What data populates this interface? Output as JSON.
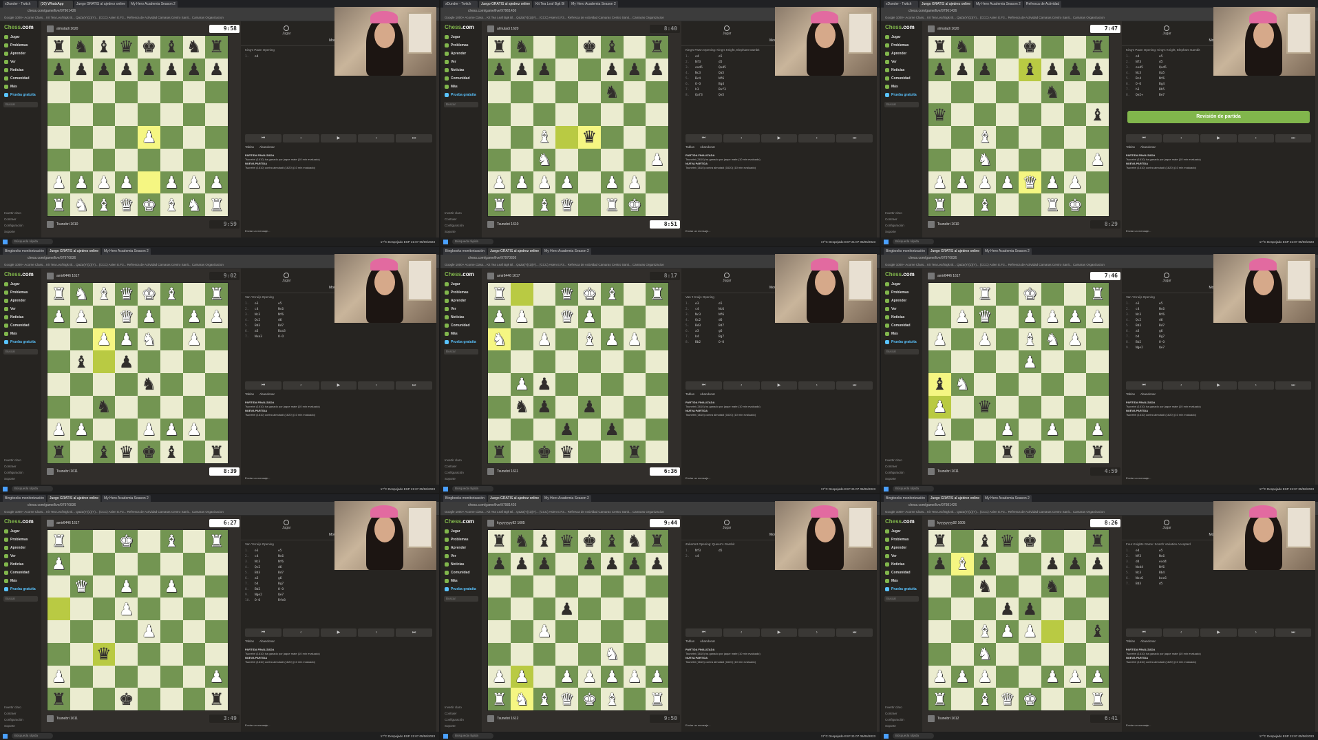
{
  "title": "Twitch VOD grid - Chess.com games",
  "cells": [
    {
      "tabs": [
        "xDunder - Twitch",
        "(30) WhatsApp",
        "Juego GRATIS al ajedrez online",
        "My Hero Academia Season 2"
      ],
      "address": "chess.com/game/live/97961436",
      "opponent": "almutadi 1620",
      "player": "Tsunebri 1610",
      "top_clock": "9:58",
      "bottom_clock": "9:59",
      "active_clock": "top",
      "opening": "King's Pawn Opening",
      "moves": [
        [
          "1.",
          "e4",
          ""
        ]
      ],
      "highlight": [
        "e2",
        "e4"
      ],
      "fen": "rnbqkbnr/pppppppp/8/8/4P3/8/PPPP1PPP/RNBQKBNR",
      "review": false
    },
    {
      "tabs": [
        "xDunder - Twitch",
        "Juego GRATIS al ajedrez online",
        "Kit Tea Leaf Bgk Bl",
        "My Hero Academia Season 2"
      ],
      "address": "chess.com/game/live/97961436",
      "opponent": "almutadi 1620",
      "player": "Tsunebri 1610",
      "top_clock": "8:40",
      "bottom_clock": "8:51",
      "active_clock": "bottom",
      "opening": "King's Pawn Opening: King's Knight, Elephant Gambit",
      "moves": [
        [
          "1.",
          "e4",
          "e5"
        ],
        [
          "2.",
          "Nf3",
          "d5"
        ],
        [
          "3.",
          "exd5",
          "Qxd5"
        ],
        [
          "4.",
          "Nc3",
          "Qa5"
        ],
        [
          "5.",
          "Bc4",
          "Nf6"
        ],
        [
          "6.",
          "O-O",
          "Bg4"
        ],
        [
          "7.",
          "h3",
          "Bxf3"
        ],
        [
          "8.",
          "Qxf3",
          "Qe5"
        ]
      ],
      "highlight": [
        "d4",
        "e4"
      ],
      "fen": "rn2kb1r/ppp2ppp/5n2/8/2B1q3/2N4P/PPPP1PP1/R1BQ1RK1",
      "review": false
    },
    {
      "tabs": [
        "xDunder - Twitch",
        "Juego GRATIS al ajedrez online",
        "My Hero Academia Season 2",
        "Refresca de Actividad"
      ],
      "address": "chess.com/game/live/97961436",
      "opponent": "almutadi 1620",
      "player": "Tsunebri 1610",
      "top_clock": "7:47",
      "bottom_clock": "8:29",
      "active_clock": "top",
      "opening": "King's Pawn Opening: King's Knight, Elephant Gambit",
      "moves": [
        [
          "1.",
          "e4",
          "e5"
        ],
        [
          "2.",
          "Nf3",
          "d5"
        ],
        [
          "3.",
          "exd5",
          "Qxd5"
        ],
        [
          "4.",
          "Nc3",
          "Qa5"
        ],
        [
          "5.",
          "Bc4",
          "Nf6"
        ],
        [
          "6.",
          "O-O",
          "Bg4"
        ],
        [
          "7.",
          "h3",
          "Bh5"
        ],
        [
          "8.",
          "Qe2+",
          "Be7"
        ]
      ],
      "highlight": [
        "e2",
        "e7"
      ],
      "fen": "rn2k2r/ppp1bppp/5n2/q6b/2B5/2N4P/PPPPQPP1/R1B2RK1",
      "review": true,
      "review_label": "Revisión de partida"
    },
    {
      "tabs": [
        "Bingbooks monitorización",
        "Juego GRATIS al ajedrez online",
        "My Hero Academia Season 2"
      ],
      "address": "chess.com/game/live/97970836",
      "opponent": "amir6446 1617",
      "player": "Tsunebri 1611",
      "top_clock": "9:02",
      "bottom_clock": "8:39",
      "active_clock": "bottom",
      "opening": "Van 't Kruijs Opening",
      "moves": [
        [
          "1.",
          "e3",
          "e5"
        ],
        [
          "2.",
          "c4",
          "Nc6"
        ],
        [
          "3.",
          "Nc3",
          "Nf6"
        ],
        [
          "4.",
          "Qc2",
          "d6"
        ],
        [
          "5.",
          "Bd3",
          "Bd7"
        ],
        [
          "6.",
          "a3",
          "Bxa3"
        ],
        [
          "7.",
          "Nxa3",
          "O-O"
        ]
      ],
      "highlight": [
        "c6",
        "c5"
      ],
      "fen": "RNBQKB1R/PP1QP1PP/2PPN1P1/1b1p4/4n3/2n5/PP2PPP1/r1bqkb1r",
      "review": false
    },
    {
      "tabs": [
        "Bingbooks monitorización",
        "Juego GRATIS al ajedrez online",
        "My Hero Academia Season 2"
      ],
      "address": "chess.com/game/live/97970836",
      "opponent": "amir6446 1617",
      "player": "Tsunebri 1611",
      "top_clock": "8:17",
      "bottom_clock": "6:36",
      "active_clock": "bottom",
      "opening": "Van 't Kruijs Opening",
      "moves": [
        [
          "1.",
          "e3",
          "e5"
        ],
        [
          "2.",
          "c4",
          "Nc6"
        ],
        [
          "3.",
          "Nc3",
          "Nf6"
        ],
        [
          "4.",
          "Qc2",
          "d6"
        ],
        [
          "5.",
          "Bd3",
          "Bd7"
        ],
        [
          "6.",
          "a3",
          "g6"
        ],
        [
          "7.",
          "b4",
          "Bg7"
        ],
        [
          "8.",
          "Bb2",
          "O-O"
        ]
      ],
      "highlight": [
        "b8",
        "a6"
      ],
      "fen": "R2QKB1R/PP1QP3/N1P1BPP1/8/1Pp5/1np1p3/3p1p2/r1kq2r1",
      "review": false
    },
    {
      "tabs": [
        "Bingbooks monitorización",
        "Juego GRATIS al ajedrez online",
        "My Hero Academia Season 2"
      ],
      "address": "chess.com/game/live/97970836",
      "opponent": "amir6446 1617",
      "player": "Tsunebri 1611",
      "top_clock": "7:46",
      "bottom_clock": "4:59",
      "active_clock": "top",
      "opening": "Van 't Kruijs Opening",
      "moves": [
        [
          "1.",
          "e3",
          "e5"
        ],
        [
          "2.",
          "c4",
          "Nc6"
        ],
        [
          "3.",
          "Nc3",
          "Nf6"
        ],
        [
          "4.",
          "Qc2",
          "d6"
        ],
        [
          "5.",
          "Bd3",
          "Bd7"
        ],
        [
          "6.",
          "a3",
          "g6"
        ],
        [
          "7.",
          "b4",
          "Bg7"
        ],
        [
          "8.",
          "Bb2",
          "O-O"
        ],
        [
          "9.",
          "Nge2",
          "Qe7"
        ]
      ],
      "highlight": [
        "a4",
        "a3"
      ],
      "fen": "2R1K2R/1PQ1PPPP/P1P1BNP1/4P3/bN6/P1q5/P2P1P1P/3rk2r",
      "review": false
    },
    {
      "tabs": [
        "Bingbooks monitorización",
        "Juego GRATIS al ajedrez online",
        "My Hero Academia Season 2"
      ],
      "address": "chess.com/game/live/97970836",
      "opponent": "amir6446 1617",
      "player": "Tsunebri 1611",
      "top_clock": "6:27",
      "bottom_clock": "3:49",
      "active_clock": "top",
      "opening": "Van 't Kruijs Opening",
      "moves": [
        [
          "1.",
          "e3",
          "e5"
        ],
        [
          "2.",
          "c4",
          "Nc6"
        ],
        [
          "3.",
          "Nc3",
          "Nf6"
        ],
        [
          "4.",
          "Qc2",
          "d6"
        ],
        [
          "5.",
          "Bd3",
          "Bd7"
        ],
        [
          "6.",
          "a3",
          "g6"
        ],
        [
          "7.",
          "b4",
          "Bg7"
        ],
        [
          "8.",
          "Bb2",
          "O-O"
        ],
        [
          "9.",
          "Nge2",
          "Qe7"
        ],
        [
          "10.",
          "O-O",
          "Rfe8"
        ]
      ],
      "highlight": [
        "a5",
        "c3"
      ],
      "fen": "R2K1B1R/P7/1Q1P1P2/3P4/4P3/2q5/P6P/r2k3r",
      "review": false
    },
    {
      "tabs": [
        "Bingbooks monitorización",
        "Juego GRATIS al ajedrez online",
        "My Hero Academia Season 2"
      ],
      "address": "chess.com/game/live/97981426",
      "opponent": "kyyyyyyyy92 1605",
      "player": "Tsunebri 1612",
      "top_clock": "9:44",
      "bottom_clock": "9:50",
      "active_clock": "top",
      "opening": "Zukertort Opening: Queen's Gambit",
      "moves": [
        [
          "1.",
          "Nf3",
          "d5"
        ],
        [
          "2.",
          "c4",
          ""
        ]
      ],
      "highlight": [
        "b1",
        "b2"
      ],
      "fen": "rnbqkbnr/ppp1pppp/8/3p4/2P5/5N2/PP1PPPPP/RNBQKB1R",
      "review": false
    },
    {
      "tabs": [
        "Bingbooks monitorización",
        "Juego GRATIS al ajedrez online",
        "My Hero Academia Season 2"
      ],
      "address": "chess.com/game/live/97981426",
      "opponent": "kyyyyyyyy92 1605",
      "player": "Tsunebri 1612",
      "top_clock": "8:26",
      "bottom_clock": "6:41",
      "active_clock": "top",
      "opening": "Four Knights Game: Scotch Variation Accepted",
      "moves": [
        [
          "1.",
          "e4",
          "e5"
        ],
        [
          "2.",
          "Nf3",
          "Nc6"
        ],
        [
          "3.",
          "d4",
          "exd4"
        ],
        [
          "4.",
          "Nxd4",
          "Nf6"
        ],
        [
          "5.",
          "Nc3",
          "Bb4"
        ],
        [
          "6.",
          "Nxc6",
          "bxc6"
        ],
        [
          "7.",
          "Bd3",
          "d5"
        ]
      ],
      "highlight": [
        "b7",
        "f4"
      ],
      "fen": "r1bqk2r/pBp2ppp/2n2n2/3pp3/2BPP2b/2N5/PPP2PPP/R1BQK2R",
      "review": false
    }
  ],
  "shared": {
    "bookmarks": "Google   1000+ Acorne Class...   Kit Tea Leaf Bgk Bl...   QaZa(Y)(1)(Y)...   (CCC) Asien E.F3...   Refresca de Actividad   Camaras Centro Sanit...   Camaras Organizacion",
    "logo": "Chess.com",
    "nav": [
      "Jugar",
      "Problemas",
      "Aprender",
      "Ver",
      "Noticias",
      "Comunidad",
      "Más"
    ],
    "trial": "Prueba gratuita",
    "search_placeholder": "Buscar",
    "footer": [
      "Invertir claro",
      "Contraer",
      "Configuración",
      "Soporte"
    ],
    "panel_tabs": [
      "Jugar",
      "Nueva Partida"
    ],
    "moves_title": "Movimientos",
    "nav_buttons": [
      "⏮",
      "‹",
      "▶",
      "›",
      "⏭"
    ],
    "actions": [
      "Tablas",
      "Abandonar"
    ],
    "chat": [
      [
        "PARTIDA FINALIZADA",
        "Tsunebri (1610) ha ganado por jaque mate (10 min evaluado)"
      ],
      [
        "NUEVA PARTIDA",
        "Tsunebri (1610) contra almutadi (1620) (10 min evaluado)"
      ]
    ],
    "chat_placeholder": "Enviar un mensaje...",
    "taskbar_search": "Búsqueda rápida",
    "tray": "17°C Despejado   ESP   21:07  05/06/2023"
  }
}
